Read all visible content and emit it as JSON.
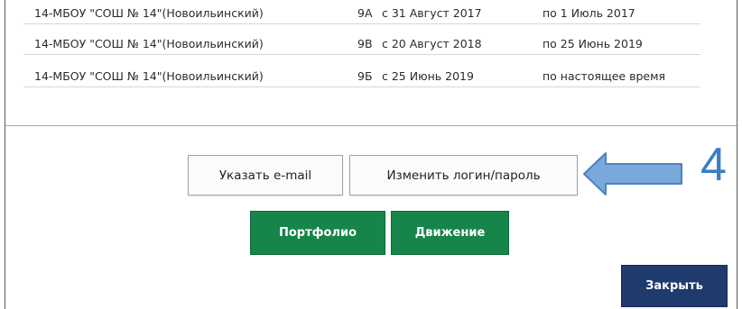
{
  "history": {
    "rows": [
      {
        "school": "14-МБОУ \"СОШ № 14\"(Новоильинский)",
        "class": "9А",
        "from": "с 31 Август 2017",
        "to": "по 1 Июль 2017"
      },
      {
        "school": "14-МБОУ \"СОШ № 14\"(Новоильинский)",
        "class": "9В",
        "from": "с 20 Август 2018",
        "to": "по 25 Июнь 2019"
      },
      {
        "school": "14-МБОУ \"СОШ № 14\"(Новоильинский)",
        "class": "9Б",
        "from": "с 25 Июнь 2019",
        "to": "по настоящее время"
      }
    ]
  },
  "actions": {
    "set_email_label": "Указать e-mail",
    "change_login_label": "Изменить логин/пароль",
    "portfolio_label": "Портфолио",
    "movement_label": "Движение",
    "close_label": "Закрыть"
  },
  "annotation": {
    "number": "4",
    "arrow_color": "#7aa7dc",
    "arrow_border": "#4f81bd"
  },
  "colors": {
    "green_button": "#16854a",
    "navy_button": "#1f3b6d"
  }
}
